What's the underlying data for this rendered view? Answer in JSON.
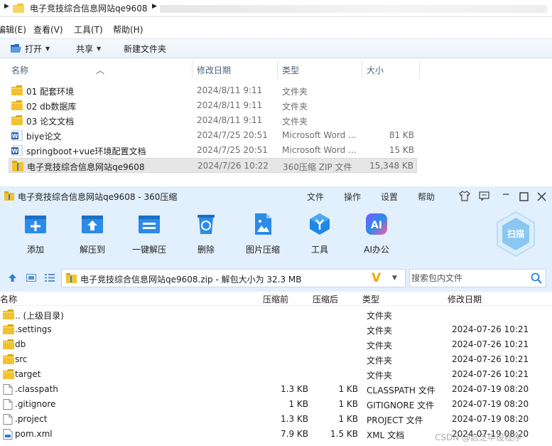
{
  "explorer": {
    "path": "电子竞技综合信息网站qe9608",
    "menu": [
      "编辑(E)",
      "查看(V)",
      "工具(T)",
      "帮助(H)"
    ],
    "toolbar": {
      "open": "打开",
      "share": "共享",
      "new_folder": "新建文件夹"
    },
    "columns": {
      "name": "名称",
      "date": "修改日期",
      "type": "类型",
      "size": "大小"
    },
    "files": [
      {
        "name": "01 配套环境",
        "date": "2024/8/11 9:11",
        "type": "文件夹",
        "size": "",
        "icon": "folder-icon"
      },
      {
        "name": "02 db数据库",
        "date": "2024/8/11 9:11",
        "type": "文件夹",
        "size": "",
        "icon": "folder-icon"
      },
      {
        "name": "03 论文文档",
        "date": "2024/8/11 9:11",
        "type": "文件夹",
        "size": "",
        "icon": "folder-icon"
      },
      {
        "name": "biye论文",
        "date": "2024/7/25 20:51",
        "type": "Microsoft Word ...",
        "size": "81 KB",
        "icon": "word-doc-icon"
      },
      {
        "name": "springboot+vue环境配置文档",
        "date": "2024/7/25 20:51",
        "type": "Microsoft Word ...",
        "size": "15 KB",
        "icon": "word-doc-icon"
      },
      {
        "name": "电子竞技综合信息网站qe9608",
        "date": "2024/7/26 10:22",
        "type": "360压缩 ZIP 文件",
        "size": "15,348 KB",
        "icon": "zip-archive-icon"
      }
    ]
  },
  "zip": {
    "title": "电子竞技综合信息网站qe9608 - 360压缩",
    "menu": [
      "文件",
      "操作",
      "设置",
      "帮助"
    ],
    "tools": [
      "添加",
      "解压到",
      "一键解压",
      "删除",
      "图片压缩",
      "工具",
      "AI办公"
    ],
    "ai_badge": "AI",
    "scan_label": "扫描",
    "path_text": "电子竞技综合信息网站qe9608.zip - 解包大小为 32.3 MB",
    "search_placeholder": "搜索包内文件",
    "columns": {
      "name": "名称",
      "packed": "压缩前",
      "compressed": "压缩后",
      "type": "类型",
      "modified": "修改日期"
    },
    "rows": [
      {
        "name": ".. (上级目录)",
        "size": "",
        "packed": "",
        "type": "文件夹",
        "date": "",
        "icon": "folder-icon"
      },
      {
        "name": ".settings",
        "size": "",
        "packed": "",
        "type": "文件夹",
        "date": "2024-07-26 10:21",
        "icon": "folder-icon"
      },
      {
        "name": "db",
        "size": "",
        "packed": "",
        "type": "文件夹",
        "date": "2024-07-26 10:21",
        "icon": "folder-icon"
      },
      {
        "name": "src",
        "size": "",
        "packed": "",
        "type": "文件夹",
        "date": "2024-07-26 10:21",
        "icon": "folder-icon"
      },
      {
        "name": "target",
        "size": "",
        "packed": "",
        "type": "文件夹",
        "date": "2024-07-26 10:21",
        "icon": "folder-icon"
      },
      {
        "name": ".classpath",
        "size": "1.3 KB",
        "packed": "1 KB",
        "type": "CLASSPATH 文件",
        "date": "2024-07-19 08:20",
        "icon": "file-icon"
      },
      {
        "name": ".gitignore",
        "size": "1 KB",
        "packed": "1 KB",
        "type": "GITIGNORE 文件",
        "date": "2024-07-19 08:20",
        "icon": "file-icon"
      },
      {
        "name": ".project",
        "size": "1.3 KB",
        "packed": "1 KB",
        "type": "PROJECT 文件",
        "date": "2024-07-19 08:20",
        "icon": "file-icon"
      },
      {
        "name": "pom.xml",
        "size": "7.9 KB",
        "packed": "1.5 KB",
        "type": "XML 文档",
        "date": "2024-07-19 08:20",
        "icon": "xml-file-icon"
      }
    ]
  },
  "watermark": "CSDN @启芝毕设程序",
  "colors": {
    "zip_bg": "#e2effc",
    "accent_blue": "#2b7fd8",
    "folder_yellow": "#f2c230",
    "selection_gray": "#e6e6e6"
  }
}
